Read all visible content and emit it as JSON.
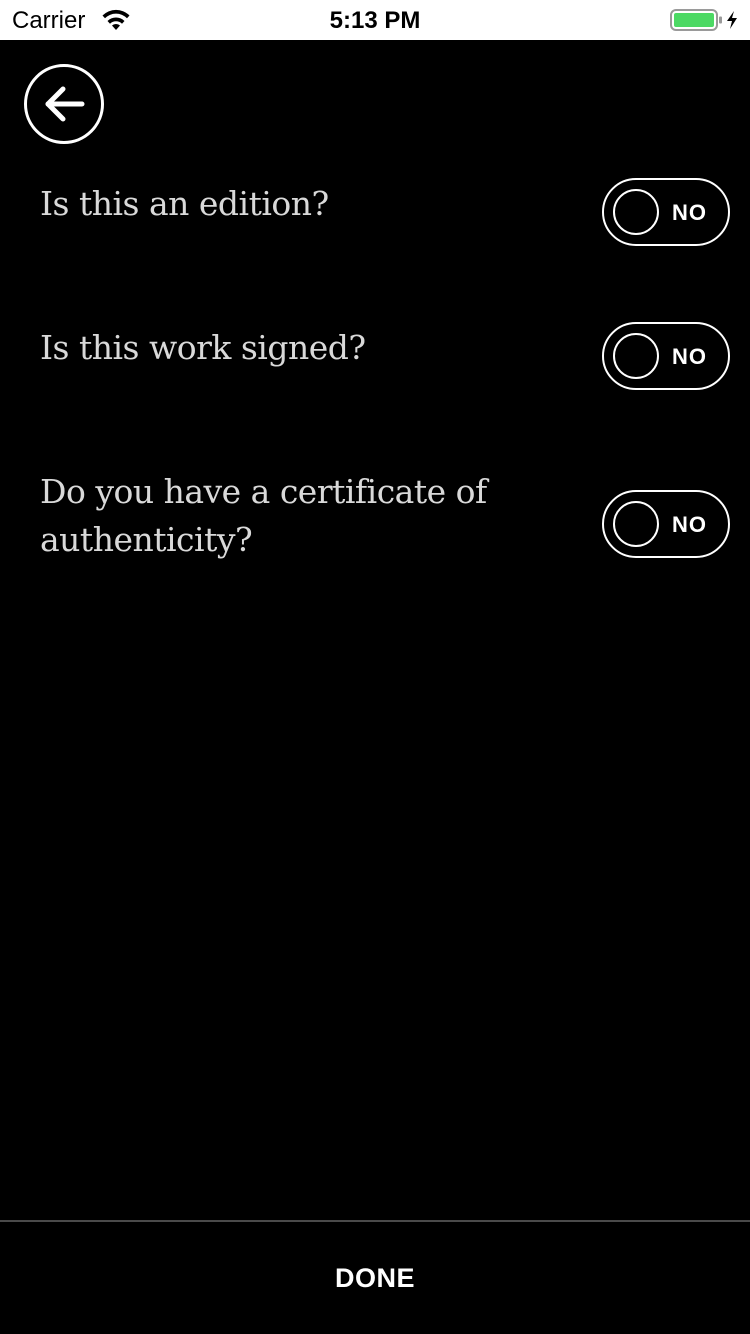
{
  "status_bar": {
    "carrier": "Carrier",
    "time": "5:13 PM",
    "battery_color": "#4cd964",
    "icons": [
      "wifi-icon",
      "battery-icon",
      "charging-bolt-icon"
    ]
  },
  "nav": {
    "back_icon": "arrow-left-icon"
  },
  "questions": [
    {
      "label": "Is this an edition?",
      "toggle_value": "NO"
    },
    {
      "label": "Is this work signed?",
      "toggle_value": "NO"
    },
    {
      "label": "Do you have a certificate of authenticity?",
      "toggle_value": "NO"
    }
  ],
  "footer": {
    "done_label": "DONE"
  },
  "colors": {
    "background": "#000000",
    "question_text": "#d9d9d9",
    "accent": "#ffffff",
    "divider": "#4a4a4a"
  }
}
